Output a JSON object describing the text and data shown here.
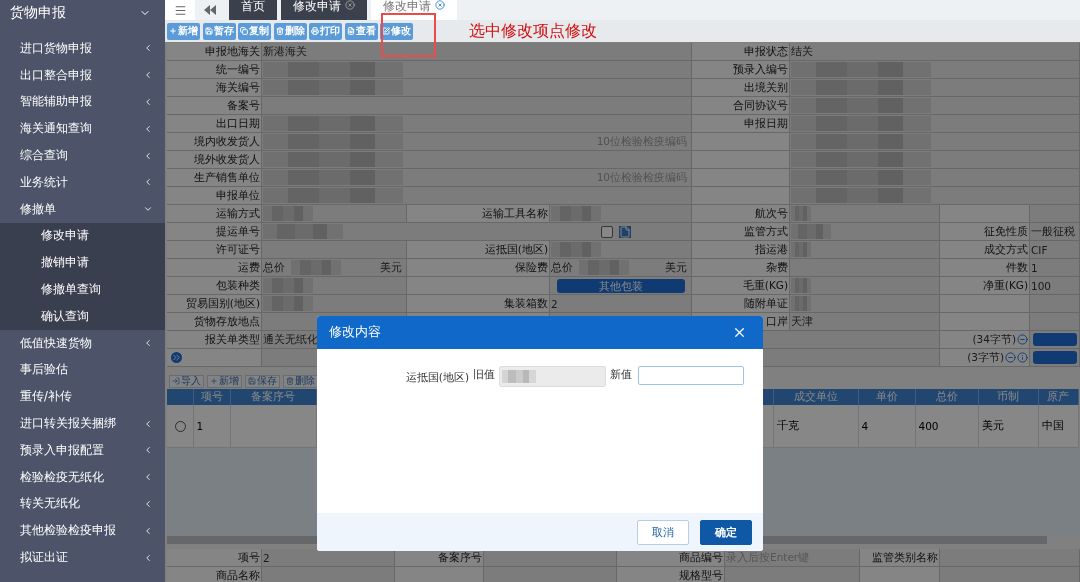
{
  "sidebar": {
    "title": "货物申报",
    "items": [
      {
        "label": "进口货物申报",
        "kind": "group",
        "expanded": false
      },
      {
        "label": "出口整合申报",
        "kind": "group",
        "expanded": false
      },
      {
        "label": "智能辅助申报",
        "kind": "group",
        "expanded": false
      },
      {
        "label": "海关通知查询",
        "kind": "group",
        "expanded": false
      },
      {
        "label": "综合查询",
        "kind": "group",
        "expanded": false
      },
      {
        "label": "业务统计",
        "kind": "group",
        "expanded": false
      },
      {
        "label": "修撤单",
        "kind": "group",
        "expanded": true,
        "children": [
          {
            "label": "修改申请"
          },
          {
            "label": "撤销申请"
          },
          {
            "label": "修撤单查询"
          },
          {
            "label": "确认查询"
          }
        ]
      },
      {
        "label": "低值快速货物",
        "kind": "group",
        "expanded": false
      },
      {
        "label": "事后验估",
        "kind": "link"
      },
      {
        "label": "重传/补传",
        "kind": "link"
      },
      {
        "label": "进口转关报关捆绑",
        "kind": "group",
        "expanded": false
      },
      {
        "label": "预录入申报配置",
        "kind": "group",
        "expanded": false
      },
      {
        "label": "检验检疫无纸化",
        "kind": "group",
        "expanded": false
      },
      {
        "label": "转关无纸化",
        "kind": "group",
        "expanded": false
      },
      {
        "label": "其他检验检疫申报",
        "kind": "group",
        "expanded": false
      },
      {
        "label": "拟证出证",
        "kind": "group",
        "expanded": false
      }
    ]
  },
  "tabs": [
    {
      "label": "首页",
      "selected": false,
      "closable": false
    },
    {
      "label": "修改申请",
      "selected": false,
      "closable": true
    },
    {
      "label": "修改申请",
      "selected": true,
      "closable": true
    }
  ],
  "toolbar": [
    "新增",
    "暂存",
    "复制",
    "删除",
    "打印",
    "查看",
    "修改"
  ],
  "annotation": {
    "text": "选中修改项点修改"
  },
  "form": {
    "rows": [
      {
        "kind": "pair",
        "fields": [
          {
            "label": "申报地海关",
            "value": "新港海关"
          },
          {
            "label": "申报状态",
            "value": "结关"
          }
        ]
      },
      {
        "kind": "pair",
        "fields": [
          {
            "label": "统一编号",
            "blurred": true
          },
          {
            "label": "预录入编号",
            "blurred": true
          }
        ]
      },
      {
        "kind": "pair",
        "fields": [
          {
            "label": "海关编号",
            "blurred": true
          },
          {
            "label": "出境关别",
            "blurred": true
          }
        ]
      },
      {
        "kind": "pair",
        "fields": [
          {
            "label": "备案号"
          },
          {
            "label": "合同协议号",
            "blurred": true
          }
        ]
      },
      {
        "kind": "pair",
        "fields": [
          {
            "label": "出口日期",
            "blurred": true
          },
          {
            "label": "申报日期",
            "blurred": true
          }
        ]
      },
      {
        "kind": "pair",
        "fields": [
          {
            "label": "境内收发货人",
            "blurred": true,
            "hint": "10位检验检疫编码"
          },
          {
            "blurred": true
          }
        ]
      },
      {
        "kind": "pair",
        "fields": [
          {
            "label": "境外收发货人",
            "blurred": true
          },
          {
            "blurred": true
          }
        ]
      },
      {
        "kind": "pair",
        "fields": [
          {
            "label": "生产销售单位",
            "blurred": true,
            "hint": "10位检验检疫编码"
          },
          {
            "blurred": true
          }
        ]
      },
      {
        "kind": "pair",
        "fields": [
          {
            "label": "申报单位",
            "blurred": true
          },
          {
            "blurred": true
          }
        ]
      },
      {
        "kind": "quad",
        "fields": [
          {
            "label": "运输方式",
            "blurred": true
          },
          {
            "label": "运输工具名称",
            "blurred": true
          },
          {
            "label": "航次号",
            "blurred": true
          }
        ]
      },
      {
        "kind": "wide",
        "fields": [
          {
            "label": "提运单号",
            "blurred": true,
            "checkbox": {
              "checked": false
            }
          },
          {
            "label": "监管方式",
            "blurred": true
          },
          {
            "label": "征免性质",
            "value": "一般征税"
          }
        ]
      },
      {
        "kind": "quad",
        "fields": [
          {
            "label": "许可证号"
          },
          {
            "label": "运抵国(地区)",
            "blurred": true
          },
          {
            "label": "指运港",
            "blurred": true
          },
          {
            "label": "成交方式",
            "value": "CIF"
          }
        ]
      },
      {
        "kind": "quad",
        "fields": [
          {
            "label": "运费",
            "prefix": "总价",
            "blurred": true,
            "unit": "美元"
          },
          {
            "label": "保险费",
            "prefix": "总价",
            "blurred": true,
            "unit": "美元"
          },
          {
            "label": "杂费"
          },
          {
            "label": "件数",
            "value": "1"
          }
        ]
      },
      {
        "kind": "quad",
        "fields": [
          {
            "label": "包装种类",
            "blurred": true
          },
          {
            "button": "其他包装"
          },
          {
            "label": "毛重(KG)",
            "blurred": true
          },
          {
            "label": "净重(KG)",
            "value": "100"
          }
        ]
      },
      {
        "kind": "quad",
        "fields": [
          {
            "label": "贸易国别(地区)",
            "blurred": true
          },
          {
            "label": "集装箱数",
            "value": "2"
          },
          {
            "label": "随附单证",
            "blurred": true
          }
        ]
      },
      {
        "kind": "quad",
        "fields": [
          {
            "label": "货物存放地点"
          },
          {
            "label": "口岸",
            "value": "天津"
          }
        ]
      },
      {
        "kind": "note",
        "expander": false,
        "label": "报关单类型",
        "value": "通关无纸化",
        "count": "(34字节)",
        "info": false
      },
      {
        "kind": "note",
        "expander": true,
        "count": "(3字节)",
        "info": true
      }
    ]
  },
  "item_toolbar": [
    "导入",
    "新增",
    "保存",
    "删除"
  ],
  "items_table": {
    "columns": [
      "项号",
      "备案序号",
      "成交单位",
      "单价",
      "总价",
      "币制",
      "原产"
    ],
    "rows": [
      {
        "selected": false,
        "cells": [
          "1",
          "",
          "千克",
          "4",
          "400",
          "美元",
          "中国"
        ]
      }
    ]
  },
  "detail_form": {
    "rows": [
      [
        {
          "label": "项号",
          "value": "2"
        },
        {
          "label": "备案序号"
        },
        {
          "label": "商品编号",
          "placeholder": "录入后按Enter键"
        },
        {
          "label": "监管类别名称"
        }
      ],
      [
        {
          "label": "商品名称"
        },
        {},
        {
          "label": "规格型号"
        },
        {}
      ]
    ]
  },
  "dialog": {
    "title": "修改内容",
    "field_label": "运抵国(地区)",
    "old_label": "旧值",
    "old_blurred": true,
    "new_label": "新值",
    "buttons": [
      {
        "label": "取消",
        "kind": "secondary"
      },
      {
        "label": "确定",
        "kind": "primary"
      }
    ]
  }
}
